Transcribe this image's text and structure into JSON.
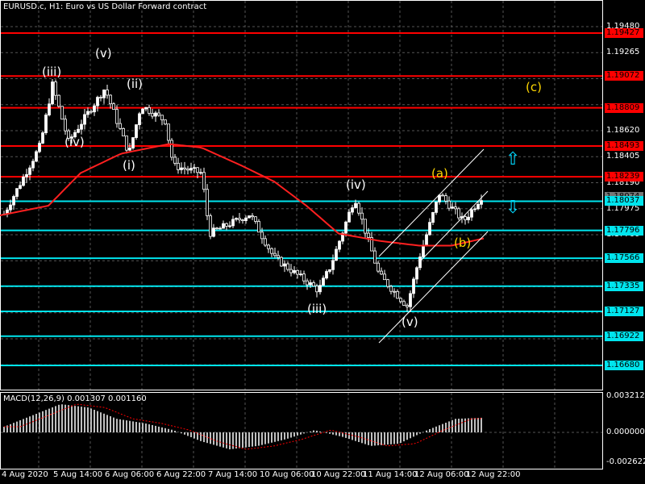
{
  "title": "EURUSD.c, H1:  Euro vs US Dollar Forward contract",
  "macd_label": "MACD(12,26,9) 0.001307 0.001160",
  "colors": {
    "bg": "#000000",
    "grid": "#555555",
    "candle": "#ffffff",
    "ma": "#ff2020",
    "resistance": "#ff0000",
    "support": "#00e5ee",
    "macd_hist": "#c0c0c0",
    "macd_signal": "#ff0000",
    "arrow": "#00d8ff",
    "wave_yellow": "#ffd700"
  },
  "price_axis": [
    "1.19480",
    "1.19265",
    "1.18620",
    "1.18405",
    "1.18190",
    "1.17975",
    "1.17760"
  ],
  "resistance_levels": [
    "1.19427",
    "1.19072",
    "1.18809",
    "1.18493",
    "1.18239"
  ],
  "support_levels": [
    "1.18037",
    "1.17796",
    "1.17566",
    "1.17335",
    "1.17127",
    "1.16922",
    "1.16680"
  ],
  "current_price": "1.18074",
  "macd_axis": [
    "0.003212",
    "0.000000",
    "-0.002622"
  ],
  "time_axis": [
    "4 Aug 2020",
    "5 Aug 14:00",
    "6 Aug 06:00",
    "6 Aug 22:00",
    "7 Aug 14:00",
    "10 Aug 06:00",
    "10 Aug 22:00",
    "11 Aug 14:00",
    "12 Aug 06:00",
    "12 Aug 22:00"
  ],
  "wave_labels": {
    "iii_top": "(iii)",
    "v_top": "(v)",
    "ii": "(ii)",
    "iv_left": "(iv)",
    "i": "(i)",
    "iv_mid": "(iv)",
    "iii_low": "(iii)",
    "v_low": "(v)",
    "a": "(a)",
    "b": "(b)",
    "c": "(c)"
  },
  "icons": {
    "up": "up-arrow-icon",
    "down": "down-arrow-icon"
  },
  "chart_data": {
    "type": "candlestick",
    "price_keypoints": [
      1.1793,
      1.185,
      1.19,
      1.1853,
      1.1897,
      1.1843,
      1.1883,
      1.187,
      1.1833,
      1.1827,
      1.1777,
      1.1793,
      1.1757,
      1.173,
      1.175,
      1.1807,
      1.1743,
      1.1717,
      1.1757,
      1.181,
      1.1787,
      1.181
    ],
    "ma_keypoints": [
      1.1792,
      1.18,
      1.1827,
      1.1843,
      1.1851,
      1.1848,
      1.1833,
      1.182,
      1.18,
      1.1777,
      1.1771,
      1.1767,
      1.1767,
      1.1773
    ],
    "macd_keypoints": [
      0.0005,
      0.0015,
      0.0025,
      0.0022,
      0.0012,
      0.0008,
      0.0002,
      -0.0008,
      -0.0015,
      -0.0012,
      -0.0006,
      0.0002,
      -0.0004,
      -0.0012,
      -0.001,
      0.0002,
      0.0012,
      0.0013
    ]
  }
}
